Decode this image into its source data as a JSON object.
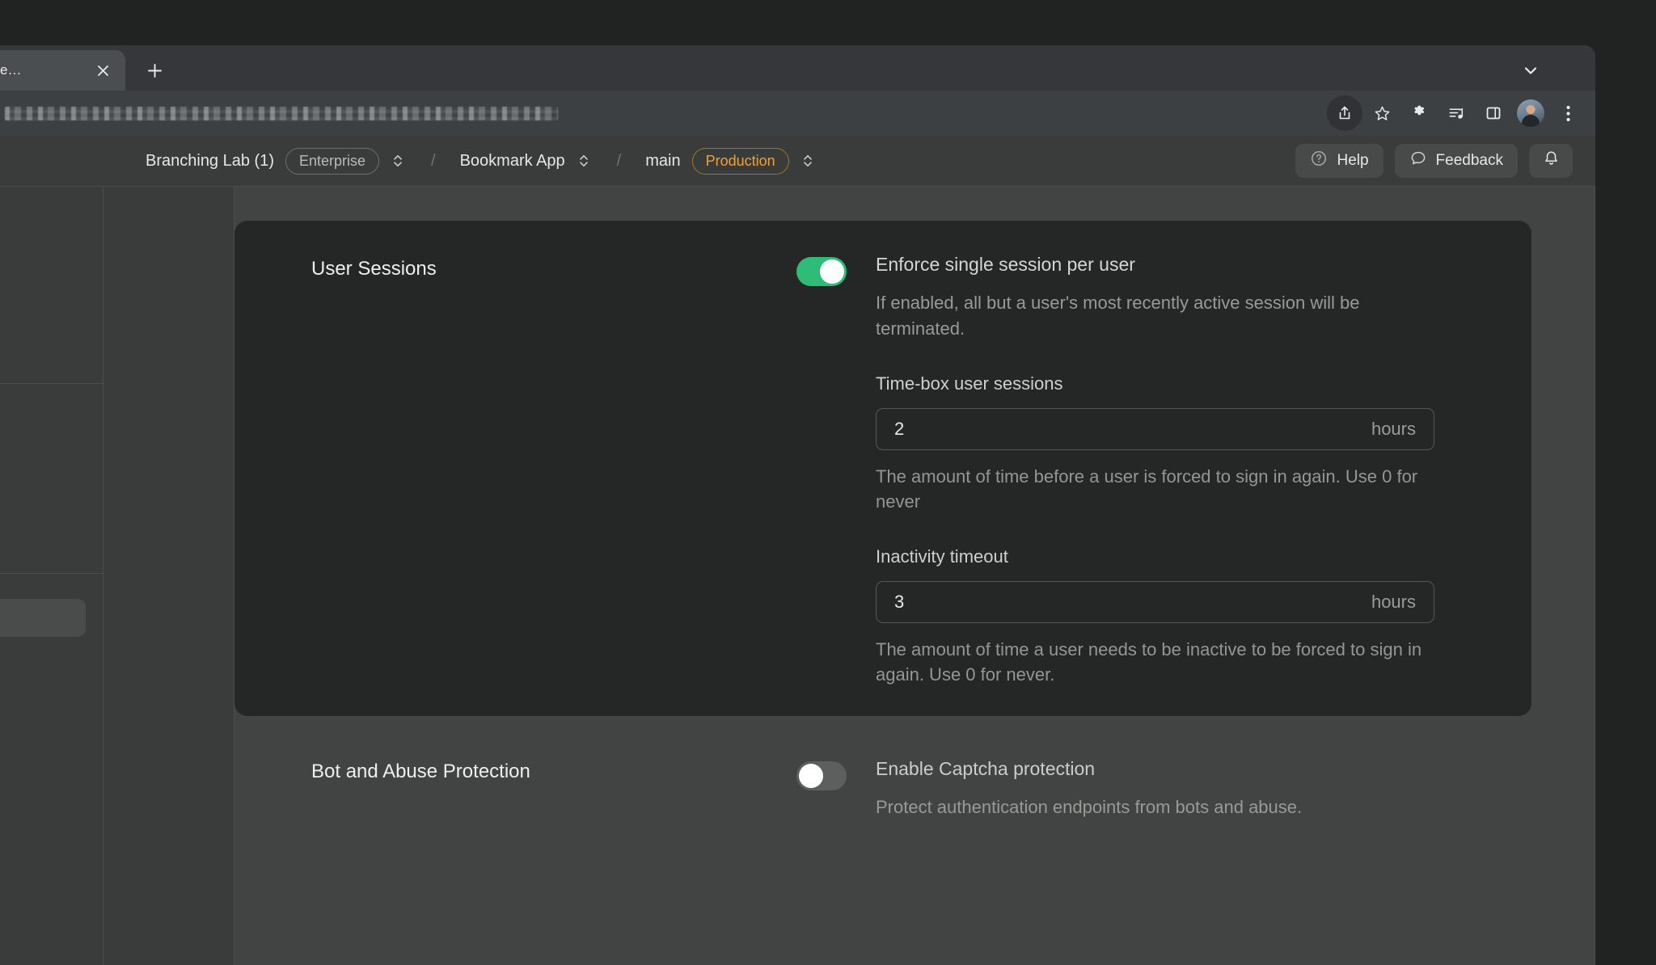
{
  "browser": {
    "tab": {
      "title": "…e",
      "close_icon": "close-icon"
    },
    "new_tab_label": "+",
    "tab_search_icon": "chevron-down-icon",
    "omnibox": {
      "value": "",
      "placeholder": ""
    },
    "toolbar_icons": [
      "share-icon",
      "bookmark-star-icon",
      "extensions-puzzle-icon",
      "reading-list-icon",
      "side-panel-icon",
      "profile-avatar",
      "three-dot-menu-icon"
    ]
  },
  "topbar": {
    "breadcrumb": {
      "org_name": "Branching Lab (1)",
      "org_plan_badge": "Enterprise",
      "separator": "/",
      "project_name": "Bookmark App",
      "branch_name": "main",
      "env_badge": "Production"
    },
    "help_label": "Help",
    "feedback_label": "Feedback",
    "notifications_icon": "bell-icon"
  },
  "sections": [
    {
      "title": "User Sessions",
      "toggle": {
        "state": "on",
        "label": "Enforce single session per user",
        "description": "If enabled, all but a user's most recently active session will be terminated."
      },
      "fields": [
        {
          "label": "Time-box user sessions",
          "value": "2",
          "suffix": "hours",
          "help": "The amount of time before a user is forced to sign in again. Use 0 for never"
        },
        {
          "label": "Inactivity timeout",
          "value": "3",
          "suffix": "hours",
          "help": "The amount of time a user needs to be inactive to be forced to sign in again. Use 0 for never."
        }
      ]
    },
    {
      "title": "Bot and Abuse Protection",
      "toggle": {
        "state": "off",
        "label": "Enable Captcha protection",
        "description": "Protect authentication endpoints from bots and abuse."
      },
      "fields": []
    }
  ],
  "colors": {
    "toggle_on": "#2dbd76",
    "toggle_off": "#5c5f5e",
    "env_badge_border": "#a9741f",
    "env_badge_text": "#e9a33c",
    "card_bg": "#252726",
    "app_bg": "#424443"
  }
}
